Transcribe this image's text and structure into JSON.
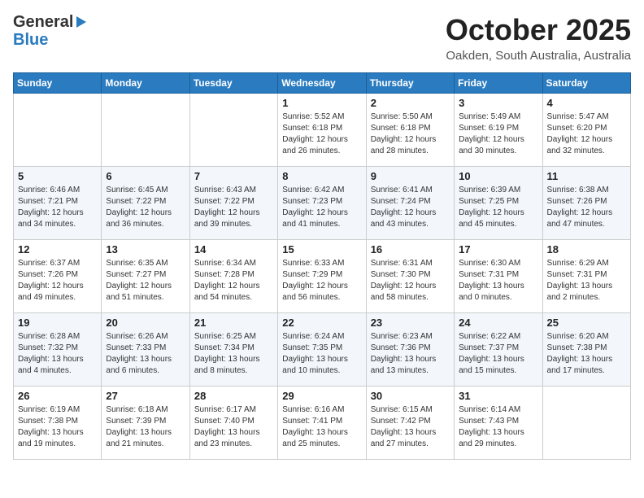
{
  "header": {
    "logo_general": "General",
    "logo_blue": "Blue",
    "month_title": "October 2025",
    "location": "Oakden, South Australia, Australia"
  },
  "days_of_week": [
    "Sunday",
    "Monday",
    "Tuesday",
    "Wednesday",
    "Thursday",
    "Friday",
    "Saturday"
  ],
  "weeks": [
    [
      {
        "day": "",
        "sunrise": "",
        "sunset": "",
        "daylight": ""
      },
      {
        "day": "",
        "sunrise": "",
        "sunset": "",
        "daylight": ""
      },
      {
        "day": "",
        "sunrise": "",
        "sunset": "",
        "daylight": ""
      },
      {
        "day": "1",
        "sunrise": "Sunrise: 5:52 AM",
        "sunset": "Sunset: 6:18 PM",
        "daylight": "Daylight: 12 hours and 26 minutes."
      },
      {
        "day": "2",
        "sunrise": "Sunrise: 5:50 AM",
        "sunset": "Sunset: 6:18 PM",
        "daylight": "Daylight: 12 hours and 28 minutes."
      },
      {
        "day": "3",
        "sunrise": "Sunrise: 5:49 AM",
        "sunset": "Sunset: 6:19 PM",
        "daylight": "Daylight: 12 hours and 30 minutes."
      },
      {
        "day": "4",
        "sunrise": "Sunrise: 5:47 AM",
        "sunset": "Sunset: 6:20 PM",
        "daylight": "Daylight: 12 hours and 32 minutes."
      }
    ],
    [
      {
        "day": "5",
        "sunrise": "Sunrise: 6:46 AM",
        "sunset": "Sunset: 7:21 PM",
        "daylight": "Daylight: 12 hours and 34 minutes."
      },
      {
        "day": "6",
        "sunrise": "Sunrise: 6:45 AM",
        "sunset": "Sunset: 7:22 PM",
        "daylight": "Daylight: 12 hours and 36 minutes."
      },
      {
        "day": "7",
        "sunrise": "Sunrise: 6:43 AM",
        "sunset": "Sunset: 7:22 PM",
        "daylight": "Daylight: 12 hours and 39 minutes."
      },
      {
        "day": "8",
        "sunrise": "Sunrise: 6:42 AM",
        "sunset": "Sunset: 7:23 PM",
        "daylight": "Daylight: 12 hours and 41 minutes."
      },
      {
        "day": "9",
        "sunrise": "Sunrise: 6:41 AM",
        "sunset": "Sunset: 7:24 PM",
        "daylight": "Daylight: 12 hours and 43 minutes."
      },
      {
        "day": "10",
        "sunrise": "Sunrise: 6:39 AM",
        "sunset": "Sunset: 7:25 PM",
        "daylight": "Daylight: 12 hours and 45 minutes."
      },
      {
        "day": "11",
        "sunrise": "Sunrise: 6:38 AM",
        "sunset": "Sunset: 7:26 PM",
        "daylight": "Daylight: 12 hours and 47 minutes."
      }
    ],
    [
      {
        "day": "12",
        "sunrise": "Sunrise: 6:37 AM",
        "sunset": "Sunset: 7:26 PM",
        "daylight": "Daylight: 12 hours and 49 minutes."
      },
      {
        "day": "13",
        "sunrise": "Sunrise: 6:35 AM",
        "sunset": "Sunset: 7:27 PM",
        "daylight": "Daylight: 12 hours and 51 minutes."
      },
      {
        "day": "14",
        "sunrise": "Sunrise: 6:34 AM",
        "sunset": "Sunset: 7:28 PM",
        "daylight": "Daylight: 12 hours and 54 minutes."
      },
      {
        "day": "15",
        "sunrise": "Sunrise: 6:33 AM",
        "sunset": "Sunset: 7:29 PM",
        "daylight": "Daylight: 12 hours and 56 minutes."
      },
      {
        "day": "16",
        "sunrise": "Sunrise: 6:31 AM",
        "sunset": "Sunset: 7:30 PM",
        "daylight": "Daylight: 12 hours and 58 minutes."
      },
      {
        "day": "17",
        "sunrise": "Sunrise: 6:30 AM",
        "sunset": "Sunset: 7:31 PM",
        "daylight": "Daylight: 13 hours and 0 minutes."
      },
      {
        "day": "18",
        "sunrise": "Sunrise: 6:29 AM",
        "sunset": "Sunset: 7:31 PM",
        "daylight": "Daylight: 13 hours and 2 minutes."
      }
    ],
    [
      {
        "day": "19",
        "sunrise": "Sunrise: 6:28 AM",
        "sunset": "Sunset: 7:32 PM",
        "daylight": "Daylight: 13 hours and 4 minutes."
      },
      {
        "day": "20",
        "sunrise": "Sunrise: 6:26 AM",
        "sunset": "Sunset: 7:33 PM",
        "daylight": "Daylight: 13 hours and 6 minutes."
      },
      {
        "day": "21",
        "sunrise": "Sunrise: 6:25 AM",
        "sunset": "Sunset: 7:34 PM",
        "daylight": "Daylight: 13 hours and 8 minutes."
      },
      {
        "day": "22",
        "sunrise": "Sunrise: 6:24 AM",
        "sunset": "Sunset: 7:35 PM",
        "daylight": "Daylight: 13 hours and 10 minutes."
      },
      {
        "day": "23",
        "sunrise": "Sunrise: 6:23 AM",
        "sunset": "Sunset: 7:36 PM",
        "daylight": "Daylight: 13 hours and 13 minutes."
      },
      {
        "day": "24",
        "sunrise": "Sunrise: 6:22 AM",
        "sunset": "Sunset: 7:37 PM",
        "daylight": "Daylight: 13 hours and 15 minutes."
      },
      {
        "day": "25",
        "sunrise": "Sunrise: 6:20 AM",
        "sunset": "Sunset: 7:38 PM",
        "daylight": "Daylight: 13 hours and 17 minutes."
      }
    ],
    [
      {
        "day": "26",
        "sunrise": "Sunrise: 6:19 AM",
        "sunset": "Sunset: 7:38 PM",
        "daylight": "Daylight: 13 hours and 19 minutes."
      },
      {
        "day": "27",
        "sunrise": "Sunrise: 6:18 AM",
        "sunset": "Sunset: 7:39 PM",
        "daylight": "Daylight: 13 hours and 21 minutes."
      },
      {
        "day": "28",
        "sunrise": "Sunrise: 6:17 AM",
        "sunset": "Sunset: 7:40 PM",
        "daylight": "Daylight: 13 hours and 23 minutes."
      },
      {
        "day": "29",
        "sunrise": "Sunrise: 6:16 AM",
        "sunset": "Sunset: 7:41 PM",
        "daylight": "Daylight: 13 hours and 25 minutes."
      },
      {
        "day": "30",
        "sunrise": "Sunrise: 6:15 AM",
        "sunset": "Sunset: 7:42 PM",
        "daylight": "Daylight: 13 hours and 27 minutes."
      },
      {
        "day": "31",
        "sunrise": "Sunrise: 6:14 AM",
        "sunset": "Sunset: 7:43 PM",
        "daylight": "Daylight: 13 hours and 29 minutes."
      },
      {
        "day": "",
        "sunrise": "",
        "sunset": "",
        "daylight": ""
      }
    ]
  ]
}
